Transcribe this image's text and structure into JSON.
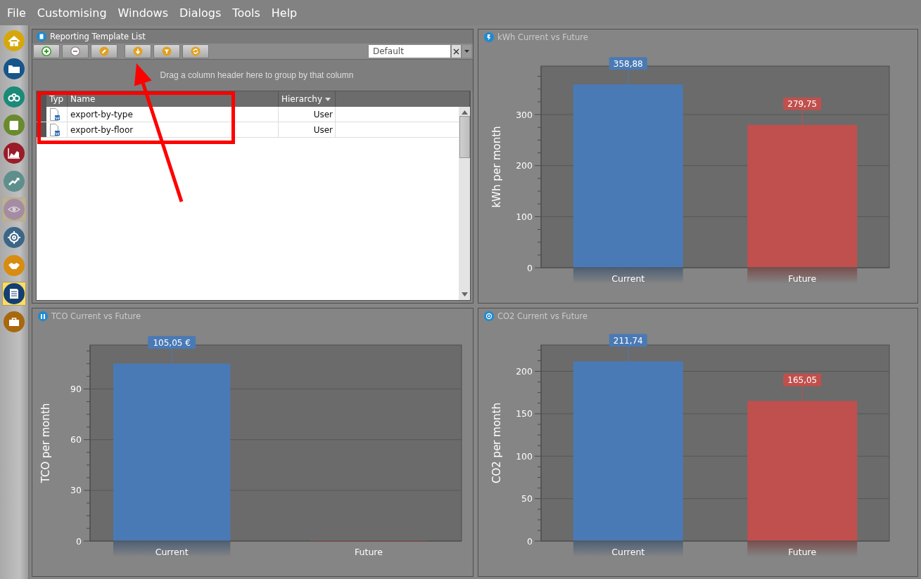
{
  "menu": [
    {
      "label": "File"
    },
    {
      "label": "Customising"
    },
    {
      "label": "Windows"
    },
    {
      "label": "Dialogs"
    },
    {
      "label": "Tools"
    },
    {
      "label": "Help"
    }
  ],
  "sidebar": {
    "items": [
      {
        "color": "#d6a70d",
        "selected": false,
        "disabled": false
      },
      {
        "color": "#17558a",
        "selected": false,
        "disabled": false
      },
      {
        "color": "#1b8a78",
        "selected": false,
        "disabled": false
      },
      {
        "color": "#6a8a2e",
        "selected": false,
        "disabled": false
      },
      {
        "color": "#9a1c28",
        "selected": false,
        "disabled": false
      },
      {
        "color": "#5e8f8c",
        "selected": false,
        "disabled": false
      },
      {
        "color": "#a48ca2",
        "selected": false,
        "disabled": true
      },
      {
        "color": "#3b6688",
        "selected": false,
        "disabled": false
      },
      {
        "color": "#d88c10",
        "selected": false,
        "disabled": false
      },
      {
        "color": "#143f72",
        "selected": true,
        "disabled": false
      },
      {
        "color": "#a8680e",
        "selected": false,
        "disabled": false
      }
    ]
  },
  "template_panel": {
    "title": "Reporting Template List",
    "toolbar": {
      "buttons": [
        {
          "disabled": false
        },
        {
          "disabled": true
        },
        {
          "disabled": false
        },
        {
          "disabled": false
        },
        {
          "disabled": false
        },
        {
          "disabled": false
        }
      ]
    },
    "layout_select": {
      "value": "Default"
    },
    "group_hint": "Drag a column header here to group by that column",
    "columns": [
      "Typ",
      "Name",
      "Hierarchy"
    ],
    "rows": [
      {
        "name": "export-by-type",
        "hierarchy": "User"
      },
      {
        "name": "export-by-floor",
        "hierarchy": "User"
      }
    ]
  },
  "charts": [
    {
      "chart_data": {
        "type": "bar",
        "title": "kWh Current vs Future",
        "ylabel": "kWh per month",
        "categories": [
          "Current",
          "Future"
        ],
        "stacked": true,
        "grid": true,
        "ylim": [
          0,
          395
        ],
        "yticks": [
          0,
          100,
          200,
          300
        ],
        "value_labels": [
          "358,88",
          "279,75"
        ],
        "series": [
          {
            "color": "#4a7ab5",
            "values": [
              358.88,
              null
            ]
          },
          {
            "color": "#c0504d",
            "values": [
              null,
              279.75
            ]
          }
        ]
      }
    },
    {
      "chart_data": {
        "type": "bar",
        "title": "TCO Current vs Future",
        "ylabel": "TCO per month",
        "categories": [
          "Current",
          "Future"
        ],
        "stacked": true,
        "grid": true,
        "ylim": [
          0,
          116
        ],
        "yticks": [
          0,
          30,
          60,
          90
        ],
        "value_labels": [
          "105,05 €",
          null
        ],
        "series": [
          {
            "color": "#4a7ab5",
            "values": [
              105.05,
              null
            ]
          },
          {
            "color": "#c0504d",
            "values": [
              null,
              0
            ]
          }
        ]
      }
    },
    {
      "chart_data": {
        "type": "bar",
        "title": "CO2 Current vs Future",
        "ylabel": "CO2 per month",
        "categories": [
          "Current",
          "Future"
        ],
        "stacked": true,
        "grid": true,
        "ylim": [
          0,
          231
        ],
        "yticks": [
          0,
          50,
          100,
          150,
          200
        ],
        "value_labels": [
          "211,74",
          "165,05"
        ],
        "series": [
          {
            "color": "#4a7ab5",
            "values": [
              211.74,
              null
            ]
          },
          {
            "color": "#c0504d",
            "values": [
              null,
              165.05
            ]
          }
        ]
      }
    }
  ],
  "annotations": [
    {
      "kind": "rectangle"
    },
    {
      "kind": "arrow"
    }
  ]
}
